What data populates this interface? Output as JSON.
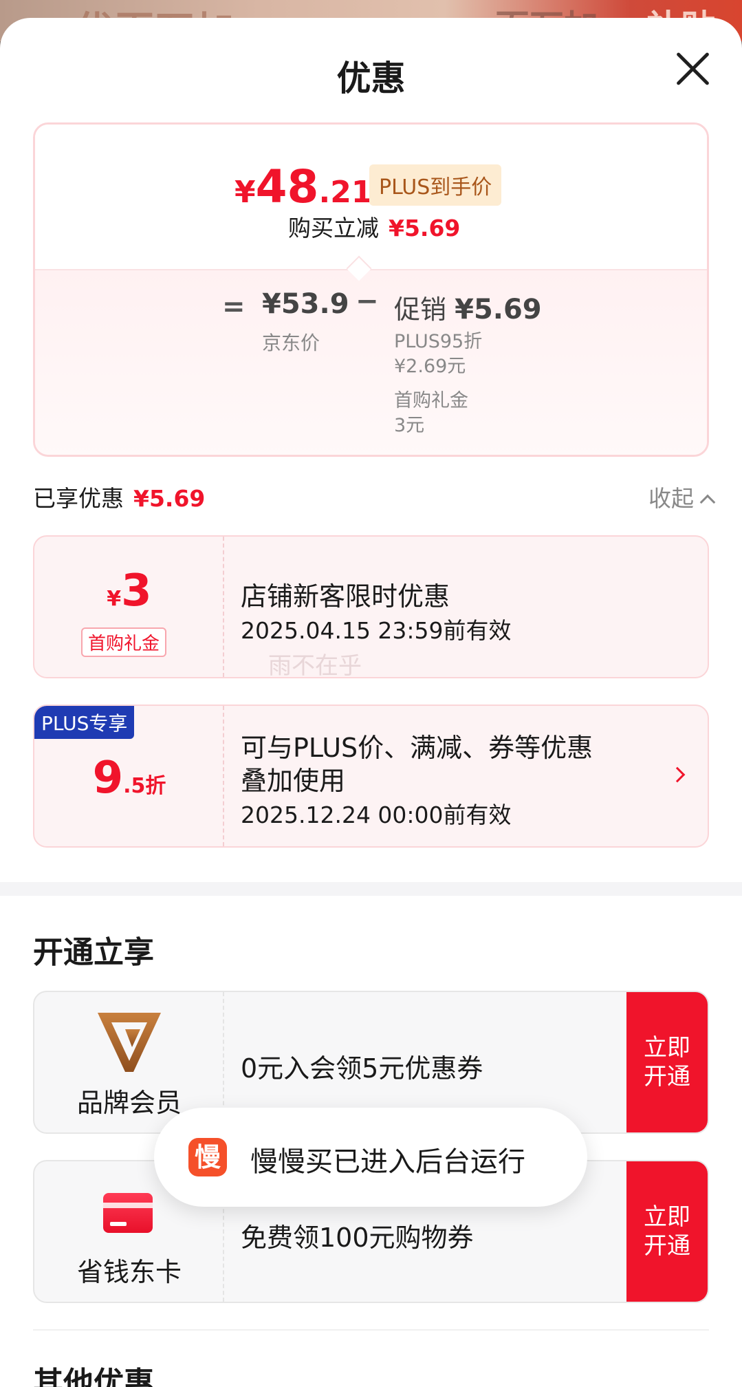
{
  "backdrop": {
    "left_text": "优百万加",
    "mid_text": "百万加",
    "right_text": "补贴"
  },
  "sheet": {
    "title": "优惠"
  },
  "price_card": {
    "yen": "¥",
    "price_int": "48",
    "price_dec": ".21",
    "badge": "PLUS到手价",
    "reduce_label": "购买立减",
    "reduce_value": "¥5.69",
    "eq": "=",
    "jd_price": "¥53.9",
    "jd_label": "京东价",
    "minus": "−",
    "promo_label": "促销",
    "promo_value": "¥5.69",
    "promo_lines": [
      "PLUS95折",
      "¥2.69元",
      "首购礼金",
      "3元"
    ]
  },
  "saved": {
    "label": "已享优惠",
    "value": "¥5.69",
    "collapse": "收起"
  },
  "coupons": [
    {
      "amount_prefix": "¥",
      "amount": "3",
      "tag": "首购礼金",
      "title": "店铺新客限时优惠",
      "date": "2025.04.15 23:59前有效",
      "watermark": "雨不在乎"
    },
    {
      "plus_tag": "PLUS专享",
      "amount": "9",
      "amount_suffix": ".5折",
      "title_line1": "可与PLUS价、满减、券等优惠",
      "title_line2": "叠加使用",
      "date": "2025.12.24 00:00前有效"
    }
  ],
  "open_section": {
    "heading": "开通立享"
  },
  "members": [
    {
      "name": "品牌会员",
      "desc": "0元入会领5元优惠券",
      "btn_line1": "立即",
      "btn_line2": "开通",
      "icon": "v-brand-icon"
    },
    {
      "name": "省钱东卡",
      "desc": "免费领100元购物券",
      "btn_line1": "立即",
      "btn_line2": "开通",
      "icon": "card-icon"
    }
  ],
  "other_section": {
    "heading": "其他优惠"
  },
  "toast": {
    "icon_char": "慢",
    "text": "慢慢买已进入后台运行"
  },
  "colors": {
    "accent_red": "#f0142b",
    "plus_blue": "#1f3bb3",
    "badge_bg": "#fdecd2"
  }
}
